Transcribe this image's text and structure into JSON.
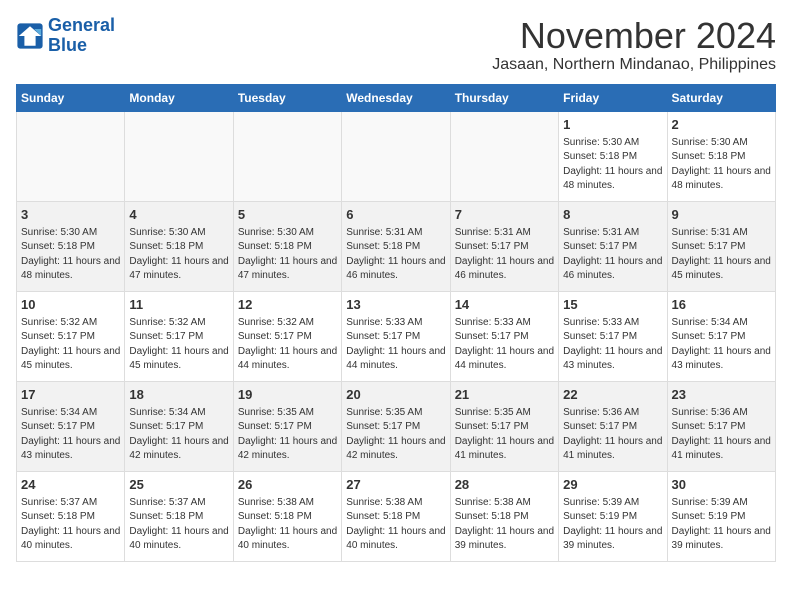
{
  "header": {
    "logo_line1": "General",
    "logo_line2": "Blue",
    "month_title": "November 2024",
    "location": "Jasaan, Northern Mindanao, Philippines"
  },
  "weekdays": [
    "Sunday",
    "Monday",
    "Tuesday",
    "Wednesday",
    "Thursday",
    "Friday",
    "Saturday"
  ],
  "weeks": [
    [
      {
        "day": "",
        "sunrise": "",
        "sunset": "",
        "daylight": ""
      },
      {
        "day": "",
        "sunrise": "",
        "sunset": "",
        "daylight": ""
      },
      {
        "day": "",
        "sunrise": "",
        "sunset": "",
        "daylight": ""
      },
      {
        "day": "",
        "sunrise": "",
        "sunset": "",
        "daylight": ""
      },
      {
        "day": "",
        "sunrise": "",
        "sunset": "",
        "daylight": ""
      },
      {
        "day": "1",
        "sunrise": "Sunrise: 5:30 AM",
        "sunset": "Sunset: 5:18 PM",
        "daylight": "Daylight: 11 hours and 48 minutes."
      },
      {
        "day": "2",
        "sunrise": "Sunrise: 5:30 AM",
        "sunset": "Sunset: 5:18 PM",
        "daylight": "Daylight: 11 hours and 48 minutes."
      }
    ],
    [
      {
        "day": "3",
        "sunrise": "Sunrise: 5:30 AM",
        "sunset": "Sunset: 5:18 PM",
        "daylight": "Daylight: 11 hours and 48 minutes."
      },
      {
        "day": "4",
        "sunrise": "Sunrise: 5:30 AM",
        "sunset": "Sunset: 5:18 PM",
        "daylight": "Daylight: 11 hours and 47 minutes."
      },
      {
        "day": "5",
        "sunrise": "Sunrise: 5:30 AM",
        "sunset": "Sunset: 5:18 PM",
        "daylight": "Daylight: 11 hours and 47 minutes."
      },
      {
        "day": "6",
        "sunrise": "Sunrise: 5:31 AM",
        "sunset": "Sunset: 5:18 PM",
        "daylight": "Daylight: 11 hours and 46 minutes."
      },
      {
        "day": "7",
        "sunrise": "Sunrise: 5:31 AM",
        "sunset": "Sunset: 5:17 PM",
        "daylight": "Daylight: 11 hours and 46 minutes."
      },
      {
        "day": "8",
        "sunrise": "Sunrise: 5:31 AM",
        "sunset": "Sunset: 5:17 PM",
        "daylight": "Daylight: 11 hours and 46 minutes."
      },
      {
        "day": "9",
        "sunrise": "Sunrise: 5:31 AM",
        "sunset": "Sunset: 5:17 PM",
        "daylight": "Daylight: 11 hours and 45 minutes."
      }
    ],
    [
      {
        "day": "10",
        "sunrise": "Sunrise: 5:32 AM",
        "sunset": "Sunset: 5:17 PM",
        "daylight": "Daylight: 11 hours and 45 minutes."
      },
      {
        "day": "11",
        "sunrise": "Sunrise: 5:32 AM",
        "sunset": "Sunset: 5:17 PM",
        "daylight": "Daylight: 11 hours and 45 minutes."
      },
      {
        "day": "12",
        "sunrise": "Sunrise: 5:32 AM",
        "sunset": "Sunset: 5:17 PM",
        "daylight": "Daylight: 11 hours and 44 minutes."
      },
      {
        "day": "13",
        "sunrise": "Sunrise: 5:33 AM",
        "sunset": "Sunset: 5:17 PM",
        "daylight": "Daylight: 11 hours and 44 minutes."
      },
      {
        "day": "14",
        "sunrise": "Sunrise: 5:33 AM",
        "sunset": "Sunset: 5:17 PM",
        "daylight": "Daylight: 11 hours and 44 minutes."
      },
      {
        "day": "15",
        "sunrise": "Sunrise: 5:33 AM",
        "sunset": "Sunset: 5:17 PM",
        "daylight": "Daylight: 11 hours and 43 minutes."
      },
      {
        "day": "16",
        "sunrise": "Sunrise: 5:34 AM",
        "sunset": "Sunset: 5:17 PM",
        "daylight": "Daylight: 11 hours and 43 minutes."
      }
    ],
    [
      {
        "day": "17",
        "sunrise": "Sunrise: 5:34 AM",
        "sunset": "Sunset: 5:17 PM",
        "daylight": "Daylight: 11 hours and 43 minutes."
      },
      {
        "day": "18",
        "sunrise": "Sunrise: 5:34 AM",
        "sunset": "Sunset: 5:17 PM",
        "daylight": "Daylight: 11 hours and 42 minutes."
      },
      {
        "day": "19",
        "sunrise": "Sunrise: 5:35 AM",
        "sunset": "Sunset: 5:17 PM",
        "daylight": "Daylight: 11 hours and 42 minutes."
      },
      {
        "day": "20",
        "sunrise": "Sunrise: 5:35 AM",
        "sunset": "Sunset: 5:17 PM",
        "daylight": "Daylight: 11 hours and 42 minutes."
      },
      {
        "day": "21",
        "sunrise": "Sunrise: 5:35 AM",
        "sunset": "Sunset: 5:17 PM",
        "daylight": "Daylight: 11 hours and 41 minutes."
      },
      {
        "day": "22",
        "sunrise": "Sunrise: 5:36 AM",
        "sunset": "Sunset: 5:17 PM",
        "daylight": "Daylight: 11 hours and 41 minutes."
      },
      {
        "day": "23",
        "sunrise": "Sunrise: 5:36 AM",
        "sunset": "Sunset: 5:17 PM",
        "daylight": "Daylight: 11 hours and 41 minutes."
      }
    ],
    [
      {
        "day": "24",
        "sunrise": "Sunrise: 5:37 AM",
        "sunset": "Sunset: 5:18 PM",
        "daylight": "Daylight: 11 hours and 40 minutes."
      },
      {
        "day": "25",
        "sunrise": "Sunrise: 5:37 AM",
        "sunset": "Sunset: 5:18 PM",
        "daylight": "Daylight: 11 hours and 40 minutes."
      },
      {
        "day": "26",
        "sunrise": "Sunrise: 5:38 AM",
        "sunset": "Sunset: 5:18 PM",
        "daylight": "Daylight: 11 hours and 40 minutes."
      },
      {
        "day": "27",
        "sunrise": "Sunrise: 5:38 AM",
        "sunset": "Sunset: 5:18 PM",
        "daylight": "Daylight: 11 hours and 40 minutes."
      },
      {
        "day": "28",
        "sunrise": "Sunrise: 5:38 AM",
        "sunset": "Sunset: 5:18 PM",
        "daylight": "Daylight: 11 hours and 39 minutes."
      },
      {
        "day": "29",
        "sunrise": "Sunrise: 5:39 AM",
        "sunset": "Sunset: 5:19 PM",
        "daylight": "Daylight: 11 hours and 39 minutes."
      },
      {
        "day": "30",
        "sunrise": "Sunrise: 5:39 AM",
        "sunset": "Sunset: 5:19 PM",
        "daylight": "Daylight: 11 hours and 39 minutes."
      }
    ]
  ]
}
